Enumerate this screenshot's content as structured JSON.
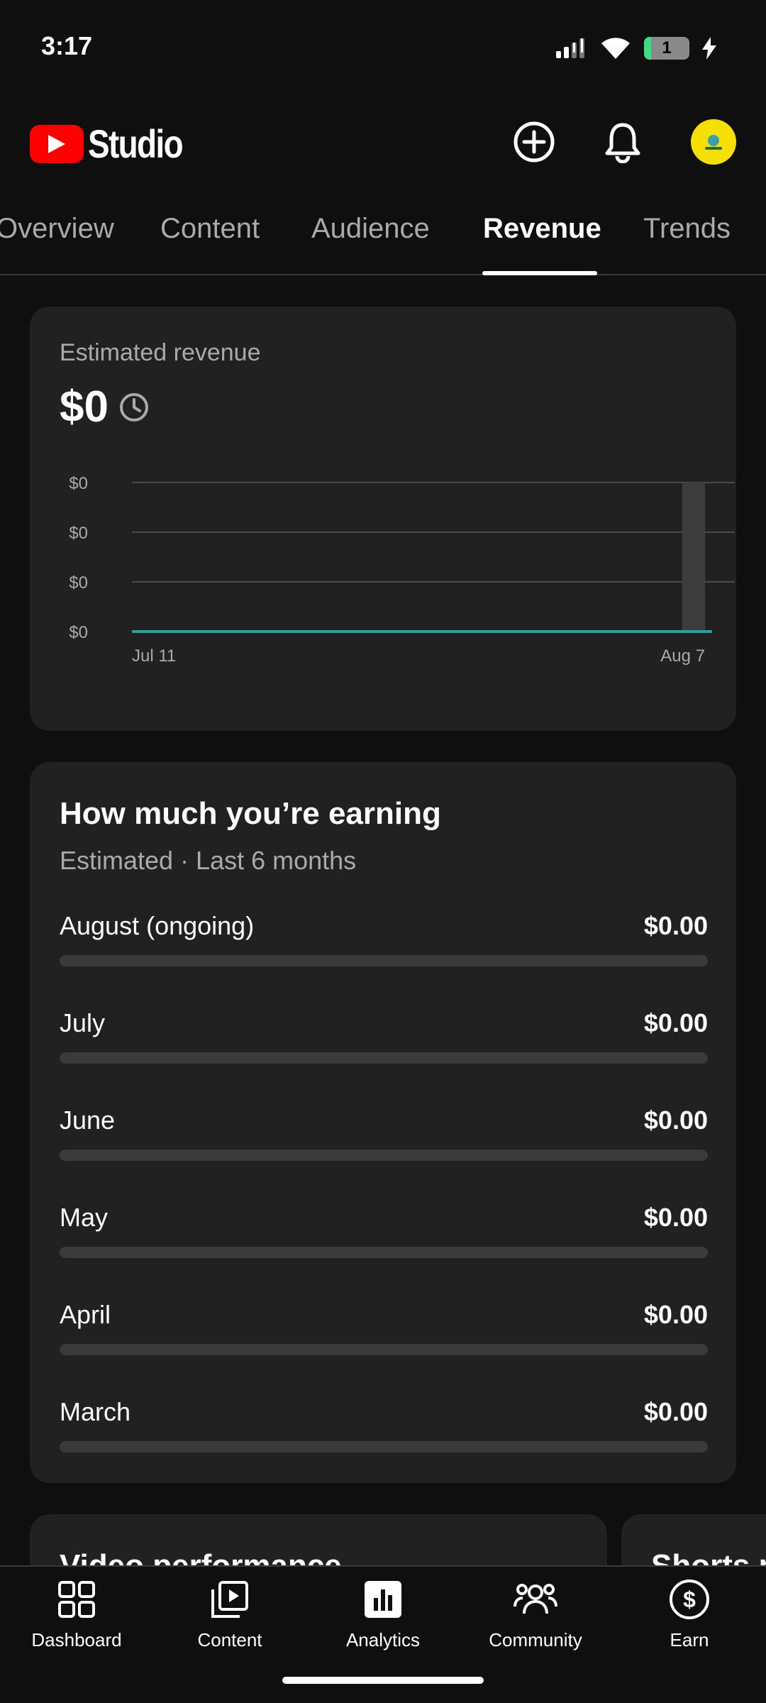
{
  "status_bar": {
    "time": "3:17",
    "battery_level": "1"
  },
  "header": {
    "app_name": "Studio",
    "brand_color": "#ff0000",
    "avatar_color": "#f5e000"
  },
  "tabs": [
    {
      "label": "Overview"
    },
    {
      "label": "Content"
    },
    {
      "label": "Audience"
    },
    {
      "label": "Revenue",
      "active": true
    },
    {
      "label": "Trends"
    }
  ],
  "revenue_card": {
    "title": "Estimated revenue",
    "amount": "$0",
    "accent_color": "#1ea59f"
  },
  "chart_data": {
    "type": "line",
    "title": "Estimated revenue",
    "y_tick_labels": [
      "$0",
      "$0",
      "$0",
      "$0"
    ],
    "x_tick_labels": [
      "Jul 11",
      "Aug 7"
    ],
    "x": [
      "Jul 11",
      "Aug 7"
    ],
    "series": [
      {
        "values": [
          0,
          0
        ]
      }
    ],
    "ylim": [
      0,
      0
    ],
    "grid": true,
    "line_color": "#1ea59f"
  },
  "earnings_card": {
    "title": "How much you’re earning",
    "subtitle": "Estimated · Last 6 months",
    "months": [
      {
        "name": "August (ongoing)",
        "value": "$0.00",
        "progress": 0
      },
      {
        "name": "July",
        "value": "$0.00",
        "progress": 0
      },
      {
        "name": "June",
        "value": "$0.00",
        "progress": 0
      },
      {
        "name": "May",
        "value": "$0.00",
        "progress": 0
      },
      {
        "name": "April",
        "value": "$0.00",
        "progress": 0
      },
      {
        "name": "March",
        "value": "$0.00",
        "progress": 0
      }
    ]
  },
  "partial_cards": {
    "video_performance": "Video performance",
    "shorts": "Shorts performance"
  },
  "bottom_nav": [
    {
      "label": "Dashboard",
      "icon": "dashboard-icon"
    },
    {
      "label": "Content",
      "icon": "content-icon"
    },
    {
      "label": "Analytics",
      "icon": "analytics-icon",
      "active": true
    },
    {
      "label": "Community",
      "icon": "community-icon"
    },
    {
      "label": "Earn",
      "icon": "earn-icon"
    }
  ]
}
